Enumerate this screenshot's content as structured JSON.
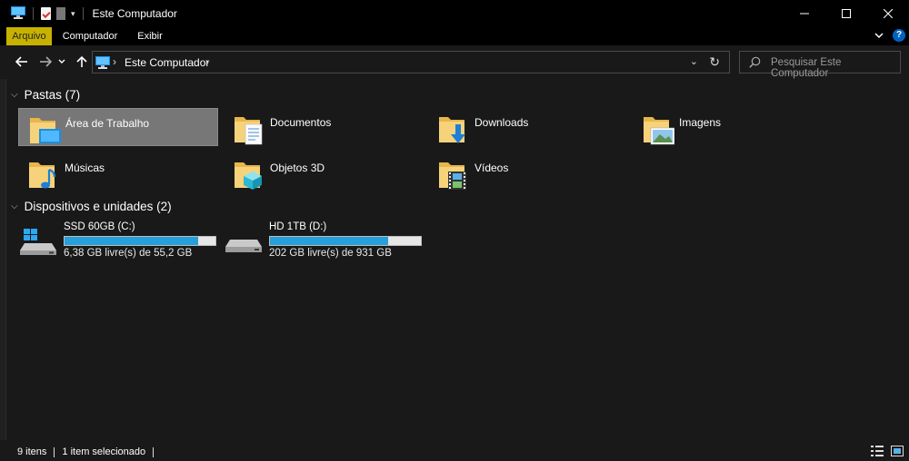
{
  "window": {
    "title": "Este Computador"
  },
  "ribbon": {
    "tabs": [
      "Arquivo",
      "Computador",
      "Exibir"
    ]
  },
  "address": {
    "location": "Este Computador"
  },
  "search": {
    "placeholder": "Pesquisar Este Computador"
  },
  "groups": {
    "folders": {
      "header": "Pastas (7)",
      "items": [
        {
          "label": "Área de Trabalho",
          "icon": "desktop-folder-icon",
          "selected": true
        },
        {
          "label": "Documentos",
          "icon": "documents-folder-icon"
        },
        {
          "label": "Downloads",
          "icon": "downloads-folder-icon"
        },
        {
          "label": "Imagens",
          "icon": "pictures-folder-icon"
        },
        {
          "label": "Músicas",
          "icon": "music-folder-icon"
        },
        {
          "label": "Objetos 3D",
          "icon": "3d-objects-folder-icon"
        },
        {
          "label": "Vídeos",
          "icon": "videos-folder-icon"
        }
      ]
    },
    "drives": {
      "header": "Dispositivos e unidades (2)",
      "items": [
        {
          "name": "SSD 60GB (C:)",
          "free": "6,38 GB livre(s) de 55,2 GB",
          "used_fraction": 0.884,
          "icon": "windows-drive-icon"
        },
        {
          "name": "HD 1TB (D:)",
          "free": "202 GB livre(s) de 931 GB",
          "used_fraction": 0.783,
          "icon": "hard-drive-icon"
        }
      ]
    }
  },
  "status": {
    "count": "9 itens",
    "selection": "1 item selecionado"
  },
  "colors": {
    "accent": "#c7b200",
    "bar_fill": "#26a0da",
    "background": "#191919"
  }
}
